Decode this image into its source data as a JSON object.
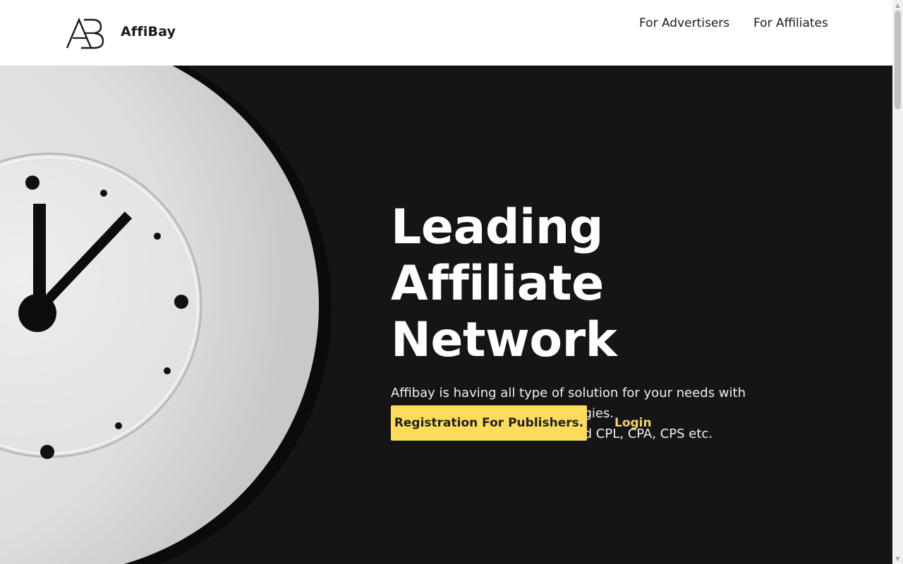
{
  "header": {
    "brand": "AffiBay",
    "logo_icon": "ab-monogram-logo",
    "nav": [
      {
        "label": "For Advertisers"
      },
      {
        "label": "For Affiliates"
      }
    ]
  },
  "hero": {
    "title_line1": "Leading Affiliate",
    "title_line2": "Network",
    "desc_line1": "Affibay is having all type of solution for your needs with performance marketing Strategies.",
    "desc_line2": "We work on Performance based CPL, CPA, CPS etc.",
    "register_label": "Registration For Publishers.",
    "login_label": "Login",
    "image": "clock-image"
  },
  "colors": {
    "hero_bg": "#151416",
    "button_bg": "#fcdc5a",
    "login_text": "#f4d35e"
  }
}
